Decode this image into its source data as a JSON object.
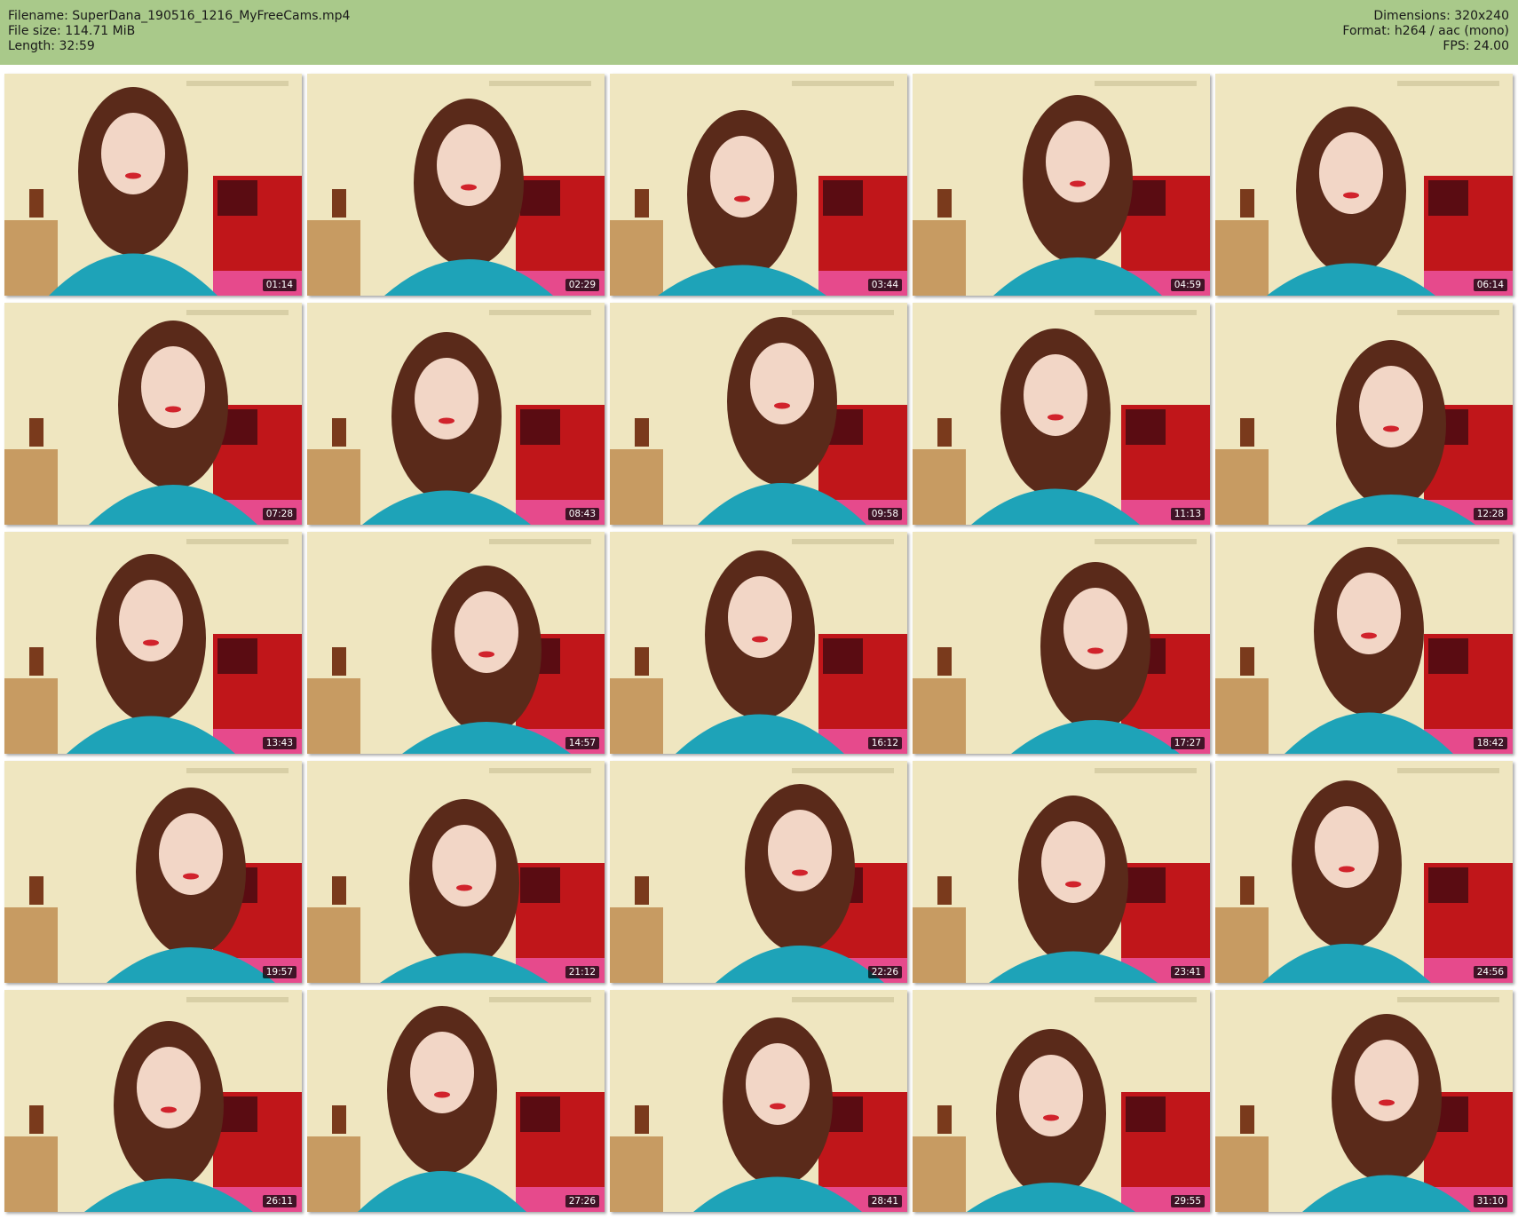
{
  "header": {
    "filename": "Filename: SuperDana_190516_1216_MyFreeCams.mp4",
    "file_size": "File size: 114.71 MiB",
    "length": "Length: 32:59",
    "dimensions": "Dimensions: 320x240",
    "format": "Format: h264 / aac (mono)",
    "fps": "FPS: 24.00"
  },
  "colors": {
    "header_bg": "#a9c98a",
    "wall": "#efe6c0",
    "hair": "#5a2a1a",
    "shirt": "#1ea3b8",
    "sofa": "#c0161a",
    "skin": "#f2d6c6"
  },
  "thumbnails": [
    {
      "time": "01:14"
    },
    {
      "time": "02:29"
    },
    {
      "time": "03:44"
    },
    {
      "time": "04:59"
    },
    {
      "time": "06:14"
    },
    {
      "time": "07:28"
    },
    {
      "time": "08:43"
    },
    {
      "time": "09:58"
    },
    {
      "time": "11:13"
    },
    {
      "time": "12:28"
    },
    {
      "time": "13:43"
    },
    {
      "time": "14:57"
    },
    {
      "time": "16:12"
    },
    {
      "time": "17:27"
    },
    {
      "time": "18:42"
    },
    {
      "time": "19:57"
    },
    {
      "time": "21:12"
    },
    {
      "time": "22:26"
    },
    {
      "time": "23:41"
    },
    {
      "time": "24:56"
    },
    {
      "time": "26:11"
    },
    {
      "time": "27:26"
    },
    {
      "time": "28:41"
    },
    {
      "time": "29:55"
    },
    {
      "time": "31:10"
    }
  ]
}
